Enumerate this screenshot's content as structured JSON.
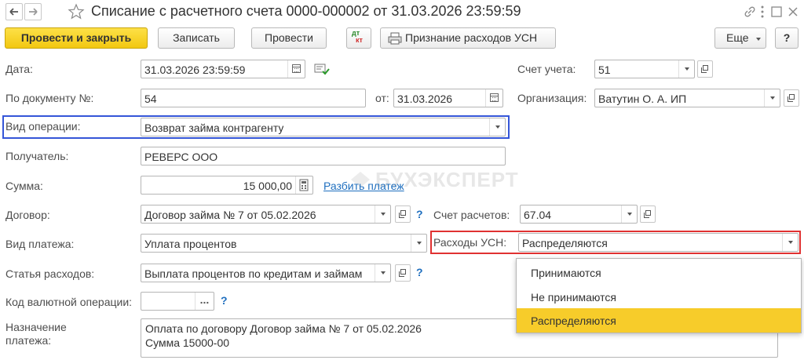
{
  "window": {
    "title": "Списание с расчетного счета 0000-000002 от 31.03.2026 23:59:59"
  },
  "toolbar": {
    "post_close": "Провести и закрыть",
    "save": "Записать",
    "post": "Провести",
    "dtkt_top": "дт",
    "dtkt_bottom": "кт",
    "usn_recognition": "Признание расходов УСН",
    "more": "Еще",
    "help": "?"
  },
  "form": {
    "date_label": "Дата:",
    "date_value": "31.03.2026 23:59:59",
    "doc_label": "По документу №:",
    "doc_number": "54",
    "from_label": "от:",
    "doc_date": "31.03.2026",
    "operation_label": "Вид операции:",
    "operation_value": "Возврат займа контрагенту",
    "recipient_label": "Получатель:",
    "recipient_value": "РЕВЕРС ООО",
    "amount_label": "Сумма:",
    "amount_value": "15 000,00",
    "split_link": "Разбить платеж",
    "contract_label": "Договор:",
    "contract_value": "Договор займа № 7 от 05.02.2026",
    "payment_type_label": "Вид платежа:",
    "payment_type_value": "Уплата процентов",
    "expense_item_label": "Статья расходов:",
    "expense_item_value": "Выплата процентов по кредитам и займам",
    "currency_code_label": "Код валютной операции:",
    "currency_code_value": "",
    "purpose_label_1": "Назначение",
    "purpose_label_2": "платежа:",
    "purpose_line_1": "Оплата по договору Договор займа № 7 от 05.02.2026",
    "purpose_line_2": "Сумма 15000-00",
    "account_label": "Счет учета:",
    "account_value": "51",
    "org_label": "Организация:",
    "org_value": "Ватутин О. А. ИП",
    "settlement_label": "Счет расчетов:",
    "settlement_value": "67.04",
    "usn_label": "Расходы УСН:",
    "usn_value": "Распределяются",
    "help_mark": "?"
  },
  "usn_dropdown": {
    "options": [
      "Принимаются",
      "Не принимаются",
      "Распределяются"
    ],
    "selected": "Распределяются"
  },
  "watermark": "БУХЭКСПЕРТ",
  "colors": {
    "primary": "#f2c811",
    "highlight_blue": "#3556d8",
    "highlight_red": "#e03131",
    "link": "#1f6fbf",
    "selected": "#f7cc2a"
  }
}
